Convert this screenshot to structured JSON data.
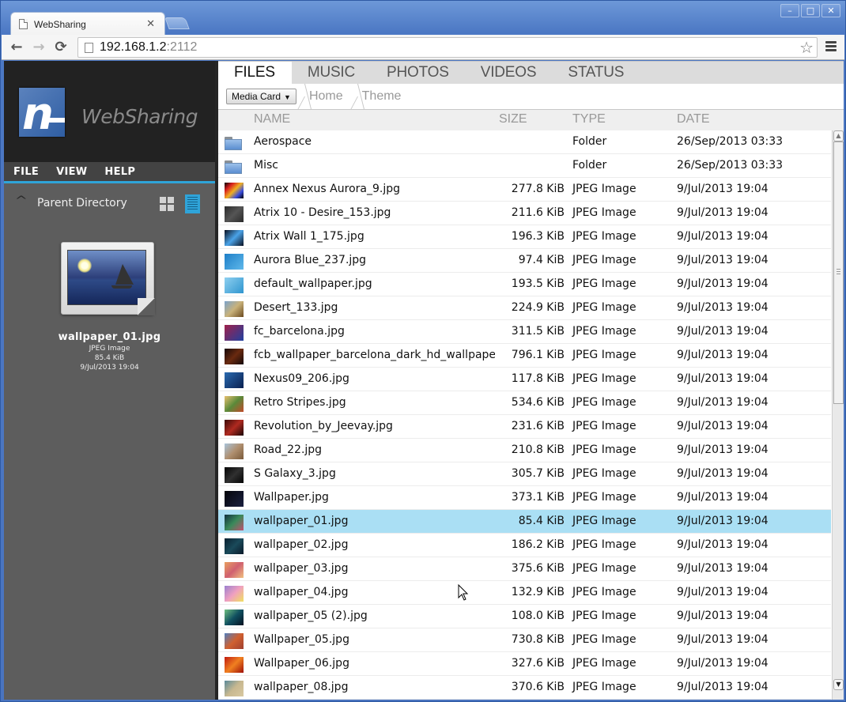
{
  "browser": {
    "tab_title": "WebSharing",
    "tab_close_icon": "close-icon",
    "url_host": "192.168.1.2",
    "url_port": ":2112",
    "nav": {
      "back": "←",
      "forward": "→",
      "reload": "⟳"
    },
    "window_controls": {
      "minimize": "–",
      "maximize": "□",
      "close": "✕"
    },
    "bookmark_icon": "☆"
  },
  "sidebar": {
    "app_name": "WebSharing",
    "logo_letter": "n",
    "menu": [
      {
        "label": "FILE"
      },
      {
        "label": "VIEW"
      },
      {
        "label": "HELP"
      }
    ],
    "parent_directory": {
      "label": "Parent Directory",
      "chevron": "^"
    },
    "view_modes": {
      "grid": "grid-view",
      "list": "list-view",
      "active": "list"
    },
    "preview": {
      "name": "wallpaper_01.jpg",
      "type": "JPEG Image",
      "size": "85.4 KiB",
      "date": "9/Jul/2013 19:04"
    }
  },
  "main": {
    "tabs": [
      {
        "label": "FILES",
        "active": true
      },
      {
        "label": "MUSIC",
        "active": false
      },
      {
        "label": "PHOTOS",
        "active": false
      },
      {
        "label": "VIDEOS",
        "active": false
      },
      {
        "label": "STATUS",
        "active": false
      }
    ],
    "storage_select": {
      "value": "Media Card",
      "arrow": "▼"
    },
    "breadcrumb": [
      "Home",
      "Theme"
    ],
    "columns": {
      "name": "NAME",
      "size": "SIZE",
      "type": "TYPE",
      "date": "DATE"
    },
    "selected_index": 16,
    "files": [
      {
        "name": "Aerospace",
        "size": "",
        "type": "Folder",
        "date": "26/Sep/2013 03:33",
        "kind": "folder",
        "colors": []
      },
      {
        "name": "Misc",
        "size": "",
        "type": "Folder",
        "date": "26/Sep/2013 03:33",
        "kind": "folder",
        "colors": []
      },
      {
        "name": "Annex Nexus Aurora_9.jpg",
        "size": "277.8 KiB",
        "type": "JPEG Image",
        "date": "9/Jul/2013 19:04",
        "kind": "image",
        "colors": [
          "#000000",
          "#d81f1f",
          "#f0b020",
          "#3a4de0",
          "#000000"
        ]
      },
      {
        "name": "Atrix 10 - Desire_153.jpg",
        "size": "211.6 KiB",
        "type": "JPEG Image",
        "date": "9/Jul/2013 19:04",
        "kind": "image",
        "colors": [
          "#2a2a2a",
          "#555555",
          "#2a2a2a"
        ]
      },
      {
        "name": "Atrix Wall 1_175.jpg",
        "size": "196.3 KiB",
        "type": "JPEG Image",
        "date": "9/Jul/2013 19:04",
        "kind": "image",
        "colors": [
          "#0a1020",
          "#4aa3e8",
          "#0a1020"
        ]
      },
      {
        "name": "Aurora Blue_237.jpg",
        "size": "97.4 KiB",
        "type": "JPEG Image",
        "date": "9/Jul/2013 19:04",
        "kind": "image",
        "colors": [
          "#1e7fc8",
          "#5fb8ea"
        ]
      },
      {
        "name": "default_wallpaper.jpg",
        "size": "193.5 KiB",
        "type": "JPEG Image",
        "date": "9/Jul/2013 19:04",
        "kind": "image",
        "colors": [
          "#8fd0f0",
          "#2f95cf"
        ]
      },
      {
        "name": "Desert_133.jpg",
        "size": "224.9 KiB",
        "type": "JPEG Image",
        "date": "9/Jul/2013 19:04",
        "kind": "image",
        "colors": [
          "#7aa2cc",
          "#c9b27a",
          "#6b4a1f"
        ]
      },
      {
        "name": "fc_barcelona.jpg",
        "size": "311.5 KiB",
        "type": "JPEG Image",
        "date": "9/Jul/2013 19:04",
        "kind": "image",
        "colors": [
          "#a0204a",
          "#2040a0"
        ]
      },
      {
        "name": "fcb_wallpaper_barcelona_dark_hd_wallpapers.jpg",
        "size": "796.1 KiB",
        "type": "JPEG Image",
        "date": "9/Jul/2013 19:04",
        "kind": "image",
        "colors": [
          "#140808",
          "#6a2a10",
          "#140808"
        ]
      },
      {
        "name": "Nexus09_206.jpg",
        "size": "117.8 KiB",
        "type": "JPEG Image",
        "date": "9/Jul/2013 19:04",
        "kind": "image",
        "colors": [
          "#2a6ab0",
          "#0a2050"
        ]
      },
      {
        "name": "Retro Stripes.jpg",
        "size": "534.6 KiB",
        "type": "JPEG Image",
        "date": "9/Jul/2013 19:04",
        "kind": "image",
        "colors": [
          "#e8c070",
          "#5a8a3a",
          "#c04a2a"
        ]
      },
      {
        "name": "Revolution_by_Jeevay.jpg",
        "size": "231.6 KiB",
        "type": "JPEG Image",
        "date": "9/Jul/2013 19:04",
        "kind": "image",
        "colors": [
          "#3a0a08",
          "#b02a20",
          "#1a0505"
        ]
      },
      {
        "name": "Road_22.jpg",
        "size": "210.8 KiB",
        "type": "JPEG Image",
        "date": "9/Jul/2013 19:04",
        "kind": "image",
        "colors": [
          "#a8c4dc",
          "#b09070",
          "#7a5a3a"
        ]
      },
      {
        "name": "S Galaxy_3.jpg",
        "size": "305.7 KiB",
        "type": "JPEG Image",
        "date": "9/Jul/2013 19:04",
        "kind": "image",
        "colors": [
          "#050505",
          "#303030",
          "#050505"
        ]
      },
      {
        "name": "Wallpaper.jpg",
        "size": "373.1 KiB",
        "type": "JPEG Image",
        "date": "9/Jul/2013 19:04",
        "kind": "image",
        "colors": [
          "#05050a",
          "#1a2040"
        ]
      },
      {
        "name": "wallpaper_01.jpg",
        "size": "85.4 KiB",
        "type": "JPEG Image",
        "date": "9/Jul/2013 19:04",
        "kind": "image",
        "colors": [
          "#103040",
          "#3a8a5a",
          "#c05070"
        ]
      },
      {
        "name": "wallpaper_02.jpg",
        "size": "186.2 KiB",
        "type": "JPEG Image",
        "date": "9/Jul/2013 19:04",
        "kind": "image",
        "colors": [
          "#0a2030",
          "#1a4a5a",
          "#0a1a2a"
        ]
      },
      {
        "name": "wallpaper_03.jpg",
        "size": "375.6 KiB",
        "type": "JPEG Image",
        "date": "9/Jul/2013 19:04",
        "kind": "image",
        "colors": [
          "#e8a060",
          "#d06070",
          "#f0c080"
        ]
      },
      {
        "name": "wallpaper_04.jpg",
        "size": "132.9 KiB",
        "type": "JPEG Image",
        "date": "9/Jul/2013 19:04",
        "kind": "image",
        "colors": [
          "#9a80d0",
          "#f0a0c0",
          "#f0e060"
        ]
      },
      {
        "name": "wallpaper_05 (2).jpg",
        "size": "108.0 KiB",
        "type": "JPEG Image",
        "date": "9/Jul/2013 19:04",
        "kind": "image",
        "colors": [
          "#70c080",
          "#105060",
          "#041020"
        ]
      },
      {
        "name": "Wallpaper_05.jpg",
        "size": "730.8 KiB",
        "type": "JPEG Image",
        "date": "9/Jul/2013 19:04",
        "kind": "image",
        "colors": [
          "#5080c0",
          "#d06030",
          "#a04030"
        ]
      },
      {
        "name": "Wallpaper_06.jpg",
        "size": "327.6 KiB",
        "type": "JPEG Image",
        "date": "9/Jul/2013 19:04",
        "kind": "image",
        "colors": [
          "#c01a10",
          "#f08020",
          "#a01008"
        ]
      },
      {
        "name": "wallpaper_08.jpg",
        "size": "370.6 KiB",
        "type": "JPEG Image",
        "date": "9/Jul/2013 19:04",
        "kind": "image",
        "colors": [
          "#5a8a9a",
          "#c8b890",
          "#d8c8a0"
        ]
      }
    ]
  },
  "theme": {
    "accent": "#2fa4d9",
    "selected_row": "#aadff4",
    "sidebar_bg": "#5d5d5d",
    "sidebar_header_bg": "#222222"
  }
}
